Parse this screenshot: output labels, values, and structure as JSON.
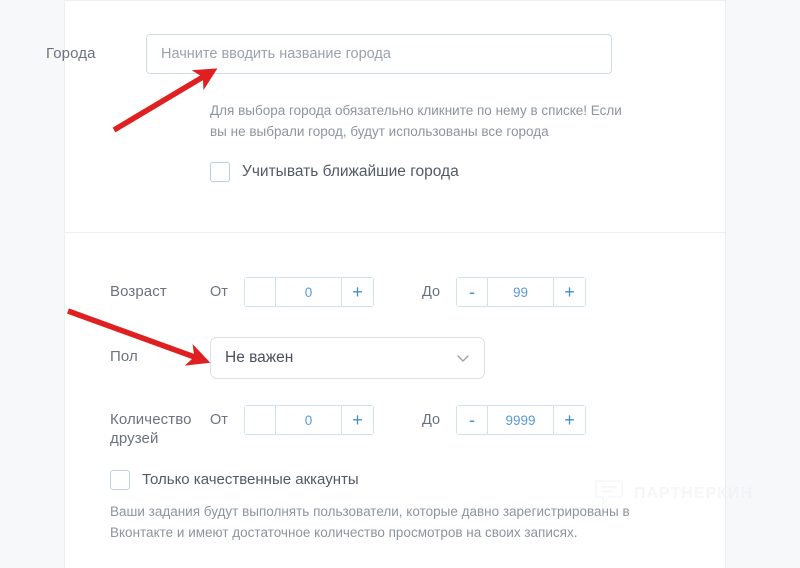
{
  "cities": {
    "label": "Города",
    "placeholder": "Начните вводить название города",
    "value": "",
    "hint": "Для выбора города обязательно кликните по нему в списке! Если вы не выбрали город, будут использованы все города",
    "nearby_checkbox_label": "Учитывать ближайшие города",
    "nearby_checked": false
  },
  "age": {
    "label": "Возраст",
    "from_word": "От",
    "to_word": "До",
    "from_minus": "-",
    "from_value": "0",
    "from_plus": "+",
    "to_minus": "-",
    "to_value": "99",
    "to_plus": "+"
  },
  "gender": {
    "label": "Пол",
    "value": "Не важен",
    "chevron": "chevron-down-icon"
  },
  "friends": {
    "label": "Количество друзей",
    "from_word": "От",
    "to_word": "До",
    "from_minus": "-",
    "from_value": "0",
    "from_plus": "+",
    "to_minus": "-",
    "to_value": "9999",
    "to_plus": "+"
  },
  "quality": {
    "checkbox_label": "Только качественные аккаунты",
    "checked": false,
    "description": "Ваши задания будут выполнять пользователи, которые давно зарегистрированы в Вконтакте и имеют достаточное количество просмотров на своих записях."
  },
  "watermark": {
    "text": "ПАРТНЕРКИН"
  },
  "annotations": {
    "arrow_1_target": "cities-input",
    "arrow_2_target": "gender-select",
    "color": "#e02020"
  },
  "colors": {
    "page_background": "#f7f8fa",
    "card_background": "#ffffff",
    "label_text": "#6b7280",
    "hint_text": "#8d949e",
    "input_border": "#cfdbe3",
    "stepper_border": "#cfe0ee",
    "stepper_accent": "#3f8fd0",
    "select_border": "#dcdfe3",
    "arrow_red": "#e02020"
  }
}
